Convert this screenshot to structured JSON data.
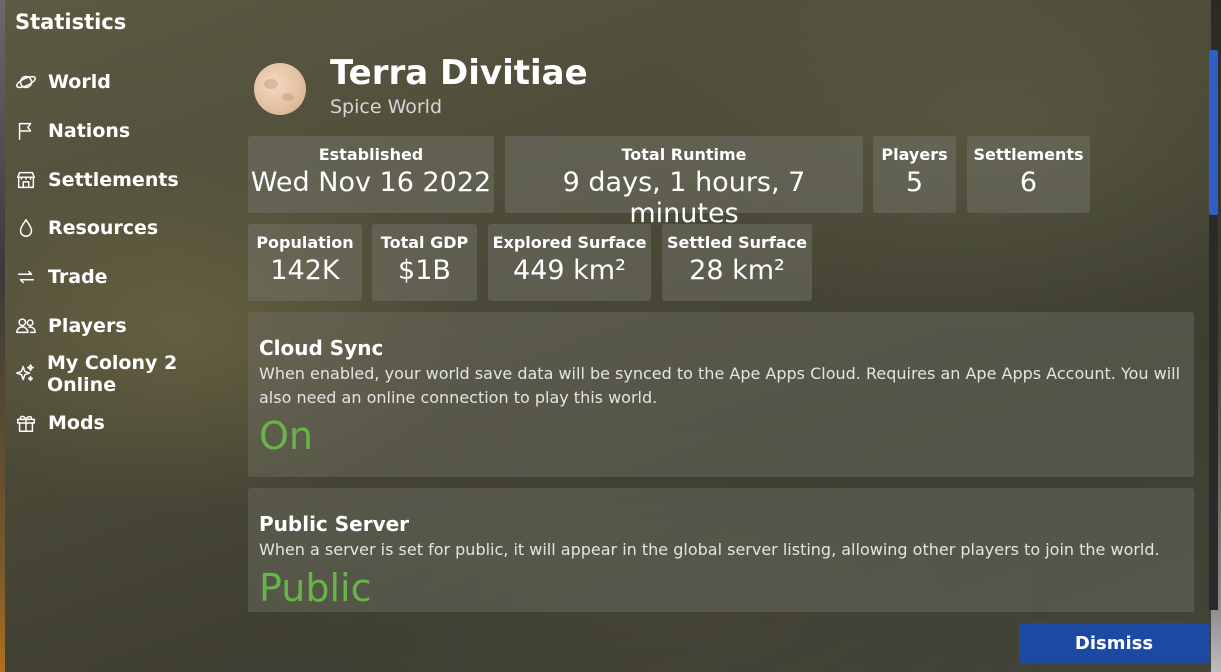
{
  "window": {
    "title": "Statistics"
  },
  "sidebar": {
    "items": [
      {
        "label": "World",
        "icon": "planet-icon"
      },
      {
        "label": "Nations",
        "icon": "flag-icon"
      },
      {
        "label": "Settlements",
        "icon": "building-icon"
      },
      {
        "label": "Resources",
        "icon": "droplet-icon"
      },
      {
        "label": "Trade",
        "icon": "exchange-icon"
      },
      {
        "label": "Players",
        "icon": "users-icon"
      },
      {
        "label": "My Colony 2 Online",
        "icon": "sparkles-icon"
      },
      {
        "label": "Mods",
        "icon": "gift-icon"
      }
    ]
  },
  "world": {
    "name": "Terra Divitiae",
    "type": "Spice World"
  },
  "stats": {
    "established": {
      "label": "Established",
      "value": "Wed Nov 16 2022"
    },
    "runtime": {
      "label": "Total Runtime",
      "value": "9 days, 1 hours, 7 minutes"
    },
    "players": {
      "label": "Players",
      "value": "5"
    },
    "settlements": {
      "label": "Settlements",
      "value": "6"
    },
    "population": {
      "label": "Population",
      "value": "142K"
    },
    "gdp": {
      "label": "Total GDP",
      "value": "$1B"
    },
    "explored": {
      "label": "Explored Surface",
      "value": "449 km²"
    },
    "settled": {
      "label": "Settled Surface",
      "value": "28 km²"
    }
  },
  "cloud_sync": {
    "title": "Cloud Sync",
    "description": "When enabled, your world save data will be synced to the Ape Apps Cloud. Requires an Ape Apps Account. You will also need an online connection to play this world.",
    "value": "On"
  },
  "public_server": {
    "title": "Public Server",
    "description": "When a server is set for public, it will appear in the global server listing, allowing other players to join the world.",
    "value": "Public"
  },
  "footer": {
    "dismiss_label": "Dismiss"
  },
  "colors": {
    "accent": "#1c4aa3",
    "scrollbar": "#2f5fc4",
    "setting_value": "#67b547"
  }
}
